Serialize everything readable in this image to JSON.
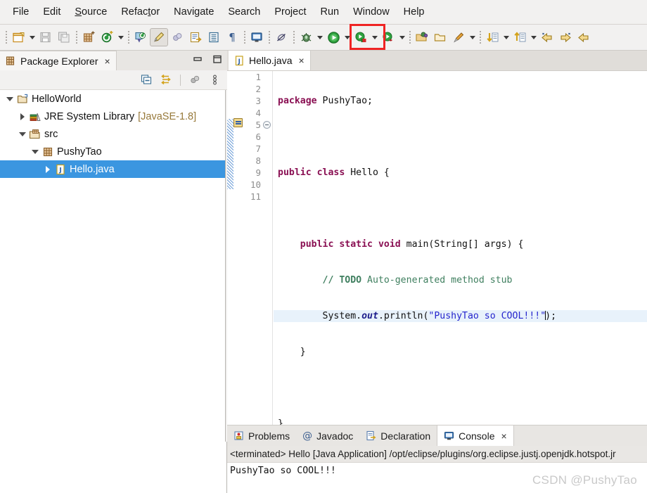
{
  "menu": {
    "items": [
      {
        "label": "File",
        "accel": ""
      },
      {
        "label": "Edit",
        "accel": ""
      },
      {
        "label": "Source",
        "accel": "S"
      },
      {
        "label": "Refactor",
        "accel": "t"
      },
      {
        "label": "Navigate",
        "accel": ""
      },
      {
        "label": "Search",
        "accel": ""
      },
      {
        "label": "Project",
        "accel": ""
      },
      {
        "label": "Run",
        "accel": ""
      },
      {
        "label": "Window",
        "accel": ""
      },
      {
        "label": "Help",
        "accel": ""
      }
    ]
  },
  "toolbar": {
    "highlight_color": "#ef2424",
    "items": [
      {
        "name": "new-wizard-icon",
        "kind": "icon"
      },
      {
        "name": "new-wizard-dropdown",
        "kind": "arrow"
      },
      {
        "name": "save-icon",
        "kind": "icon"
      },
      {
        "name": "save-all-icon",
        "kind": "icon"
      },
      {
        "name": "separator-1",
        "kind": "sep"
      },
      {
        "name": "new-java-package-icon",
        "kind": "icon"
      },
      {
        "name": "new-java-class-icon",
        "kind": "icon"
      },
      {
        "name": "new-java-class-dropdown",
        "kind": "arrow"
      },
      {
        "name": "separator-2",
        "kind": "sep"
      },
      {
        "name": "open-type-icon",
        "kind": "icon"
      },
      {
        "name": "toggle-mark-occurrences-icon",
        "kind": "icon-pressed"
      },
      {
        "name": "skip-breakpoints-icon",
        "kind": "icon"
      },
      {
        "name": "open-task-icon",
        "kind": "icon"
      },
      {
        "name": "show-whitespace-icon",
        "kind": "icon"
      },
      {
        "name": "pilcrow-icon",
        "kind": "icon"
      },
      {
        "name": "separator-3",
        "kind": "sep"
      },
      {
        "name": "open-console-icon",
        "kind": "icon"
      },
      {
        "name": "separator-4",
        "kind": "sep"
      },
      {
        "name": "disable-breakpoints-icon",
        "kind": "icon"
      },
      {
        "name": "separator-5",
        "kind": "sep"
      },
      {
        "name": "debug-icon",
        "kind": "icon"
      },
      {
        "name": "debug-dropdown",
        "kind": "arrow"
      },
      {
        "name": "run-icon",
        "kind": "icon"
      },
      {
        "name": "run-dropdown",
        "kind": "arrow"
      },
      {
        "name": "run-external-tools-icon",
        "kind": "icon"
      },
      {
        "name": "run-external-dropdown",
        "kind": "arrow"
      },
      {
        "name": "coverage-icon",
        "kind": "icon"
      },
      {
        "name": "coverage-dropdown",
        "kind": "arrow"
      },
      {
        "name": "separator-6",
        "kind": "sep"
      },
      {
        "name": "open-package-icon",
        "kind": "icon"
      },
      {
        "name": "open-folder-icon",
        "kind": "icon"
      },
      {
        "name": "new-launch-icon",
        "kind": "icon"
      },
      {
        "name": "new-launch-dropdown",
        "kind": "arrow"
      },
      {
        "name": "separator-7",
        "kind": "sep"
      },
      {
        "name": "next-annotation-icon",
        "kind": "icon"
      },
      {
        "name": "next-annotation-dropdown",
        "kind": "arrow"
      },
      {
        "name": "previous-annotation-icon",
        "kind": "icon"
      },
      {
        "name": "previous-annotation-dropdown",
        "kind": "arrow"
      },
      {
        "name": "back-icon",
        "kind": "icon"
      },
      {
        "name": "forward-icon",
        "kind": "icon"
      },
      {
        "name": "back-history-icon",
        "kind": "icon"
      }
    ]
  },
  "package_explorer": {
    "tab_label": "Package Explorer",
    "tab_close": "×",
    "minimize_tooltip": "Minimize",
    "maximize_tooltip": "Maximize",
    "view_tools": [
      "collapse-all-icon",
      "link-with-editor-icon",
      "view-filter-icon",
      "view-menu-icon"
    ],
    "tree": [
      {
        "label": "HelloWorld",
        "version": "",
        "indent": 0,
        "twisty": "down",
        "icon": "java-project-icon",
        "selected": false
      },
      {
        "label": "JRE System Library",
        "version": "[JavaSE-1.8]",
        "indent": 1,
        "twisty": "right",
        "icon": "library-icon",
        "selected": false
      },
      {
        "label": "src",
        "version": "",
        "indent": 1,
        "twisty": "down",
        "icon": "source-folder-icon",
        "selected": false
      },
      {
        "label": "PushyTao",
        "version": "",
        "indent": 2,
        "twisty": "down",
        "icon": "package-icon",
        "selected": false
      },
      {
        "label": "Hello.java",
        "version": "",
        "indent": 3,
        "twisty": "right",
        "icon": "java-file-icon",
        "selected": true
      }
    ]
  },
  "editor": {
    "tab_label": "Hello.java",
    "tab_close": "×",
    "tab_icon": "java-file-icon",
    "current_line": 7,
    "line_numbers": [
      "1",
      "2",
      "3",
      "4",
      "5",
      "6",
      "7",
      "8",
      "9",
      "10",
      "11"
    ],
    "lines": [
      {
        "n": "1",
        "text": "package PushyTao;"
      },
      {
        "n": "2",
        "text": ""
      },
      {
        "n": "3",
        "text": "public class Hello {"
      },
      {
        "n": "4",
        "text": ""
      },
      {
        "n": "5",
        "text": "    public static void main(String[] args) {"
      },
      {
        "n": "6",
        "text": "        // TODO Auto-generated method stub"
      },
      {
        "n": "7",
        "text": "        System.out.println(\"PushyTao so COOL!!!\");"
      },
      {
        "n": "8",
        "text": "    }"
      },
      {
        "n": "9",
        "text": ""
      },
      {
        "n": "10",
        "text": "}"
      },
      {
        "n": "11",
        "text": ""
      }
    ],
    "tokens": {
      "kw_package": "package",
      "pkg_name": " PushyTao;",
      "kw_public": "public",
      "kw_class": "class",
      "class_name": " Hello {",
      "kw_static": "static",
      "kw_void": "void",
      "main_sig": " main(String[] args) {",
      "comment_todo": "// TODO",
      "comment_rest": " Auto-generated method stub",
      "sysout_pre": "System.",
      "sysout_field": "out",
      "sysout_mid": ".println(",
      "sysout_str": "\"PushyTao so COOL!!!\"",
      "sysout_post": ");",
      "brace_close_inner": "}",
      "brace_close_outer": "}"
    }
  },
  "bottom_panel": {
    "tabs": [
      {
        "label": "Problems",
        "icon": "problems-icon",
        "active": false,
        "closable": false
      },
      {
        "label": "Javadoc",
        "icon": "javadoc-icon",
        "active": false,
        "closable": false
      },
      {
        "label": "Declaration",
        "icon": "declaration-icon",
        "active": false,
        "closable": false
      },
      {
        "label": "Console",
        "icon": "console-icon",
        "active": true,
        "closable": true
      }
    ],
    "close_glyph": "×",
    "launch_header": "<terminated> Hello [Java Application] /opt/eclipse/plugins/org.eclipse.justj.openjdk.hotspot.jr",
    "output": "PushyTao so COOL!!!"
  },
  "watermark": {
    "text": "CSDN @PushyTao"
  }
}
